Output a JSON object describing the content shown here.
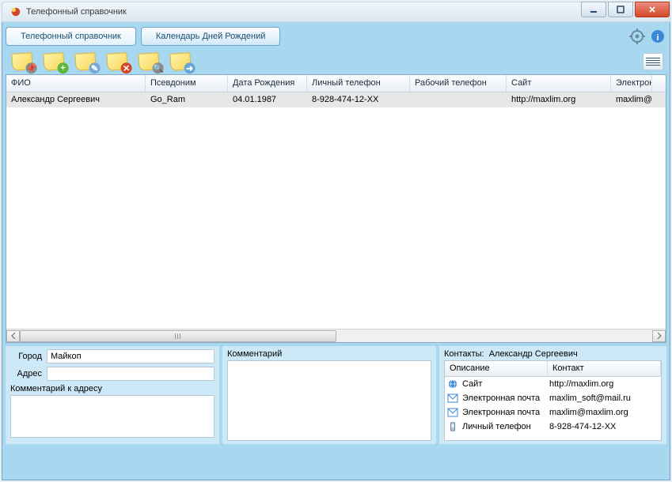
{
  "window": {
    "title": "Телефонный справочник"
  },
  "tabs": {
    "directory": "Телефонный справочник",
    "calendar": "Календарь Дней Рождений"
  },
  "grid": {
    "headers": {
      "fio": "ФИО",
      "nick": "Псевдоним",
      "dob": "Дата Рождения",
      "pphone": "Личный телефон",
      "wphone": "Рабочий телефон",
      "site": "Сайт",
      "email": "Электрон"
    },
    "row": {
      "fio": "Александр Сергеевич",
      "nick": "Go_Ram",
      "dob": "04.01.1987",
      "pphone": "8-928-474-12-XX",
      "wphone": "",
      "site": "http://maxlim.org",
      "email": "maxlim@m"
    }
  },
  "details": {
    "city_label": "Город",
    "city": "Майкоп",
    "addr_label": "Адрес",
    "addr": "",
    "addr_comment_label": "Комментарий к адресу",
    "comment_label": "Комментарий",
    "contacts_label": "Контакты:",
    "contacts_name": "Александр Сергеевич",
    "cgrid": {
      "h_desc": "Описание",
      "h_val": "Контакт",
      "rows": [
        {
          "icon": "globe",
          "desc": "Сайт",
          "val": "http://maxlim.org"
        },
        {
          "icon": "mail",
          "desc": "Электронная почта",
          "val": "maxlim_soft@mail.ru"
        },
        {
          "icon": "mail",
          "desc": "Электронная почта",
          "val": "maxlim@maxlim.org"
        },
        {
          "icon": "phone",
          "desc": "Личный телефон",
          "val": "8-928-474-12-XX"
        }
      ]
    }
  }
}
